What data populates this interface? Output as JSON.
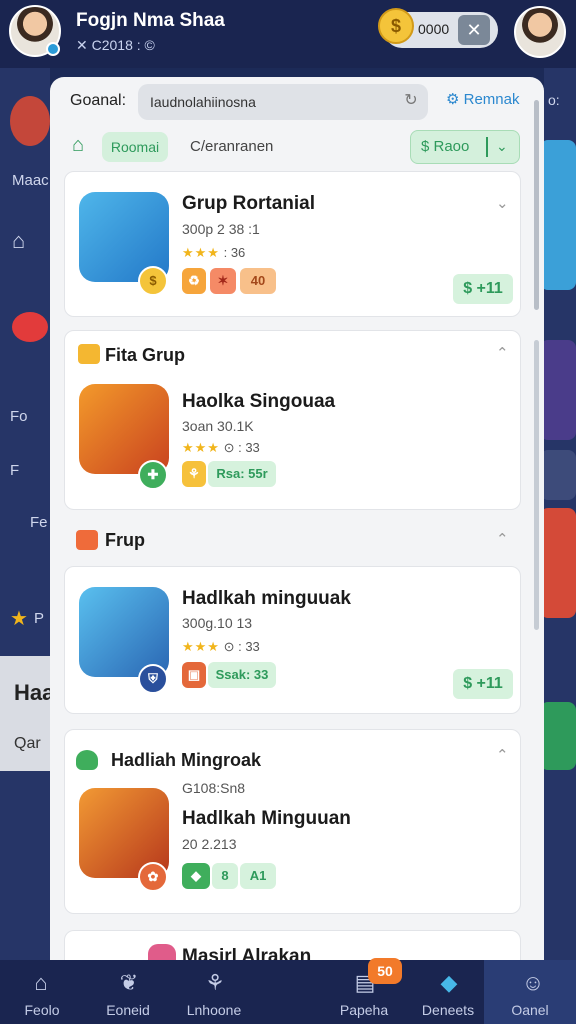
{
  "header": {
    "user_name": "Fogjn Nma Shaa",
    "user_sub": "✕ C2018 : ©",
    "coin_symbol": "$",
    "coin_amount": "0000",
    "close_symbol": "✕"
  },
  "background": {
    "side_labels": [
      "Maac",
      "Fo",
      "F",
      "Fe",
      "P"
    ],
    "sheet_title": "Haa",
    "sheet_sub": "Qar"
  },
  "panel": {
    "search_label": "Goanal:",
    "search_value": "Iaudnolahiinosna",
    "remove_label": "Remnak",
    "filter_active": "Roomai",
    "filter_other": "C/eranranen",
    "dropdown_label": "$ Raoo"
  },
  "cards": [
    {
      "title": "Grup Rortanial",
      "sub": "300p 2 38 :1",
      "rating_stars": "★★★",
      "rating_text": ": 36",
      "tags": [
        "♻",
        "✶",
        "40"
      ],
      "price": "$ +11"
    },
    {
      "section": "Fita Grup",
      "title": "Haolka Singouaa",
      "sub": "3oan 30.1K",
      "rating_stars": "★★★",
      "rating_text": "⊙ : 33",
      "tags": [
        "⚘",
        "Rsa: 55r"
      ]
    },
    {
      "section": "Frup",
      "title": "Hadlkah minguuak",
      "sub": "300g.10 13",
      "rating_stars": "★★★",
      "rating_text": "⊙ : 33",
      "tags": [
        "▣",
        "Ssak: 33"
      ],
      "price": "$ +11"
    },
    {
      "section": "Hadliah Mingroak",
      "title": "Hadlkah Minguuan",
      "sub": "G108:Sn8",
      "sub2": "20 2.213",
      "tags": [
        "◆",
        "8",
        "A1"
      ]
    },
    {
      "title": "Masirl Alrakan"
    }
  ],
  "bottom_nav": [
    {
      "label": "Feolo",
      "icon": "⌂"
    },
    {
      "label": "Eoneid",
      "icon": "❦"
    },
    {
      "label": "Lnhoone",
      "icon": "⚘"
    },
    {
      "label": "Papeha",
      "icon": "▤"
    },
    {
      "label": "Deneets",
      "icon": "◆"
    },
    {
      "label": "Oanel",
      "icon": "☺"
    }
  ],
  "nav_badge": "50"
}
